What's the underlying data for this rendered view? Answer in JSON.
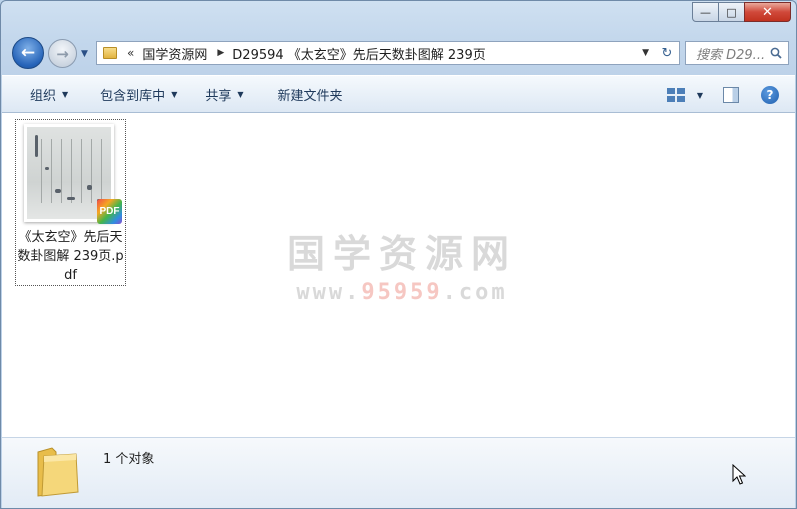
{
  "window": {
    "caption": {
      "minimize": "—",
      "maximize": "□",
      "close": "✕"
    }
  },
  "nav": {
    "address_prefix": "«",
    "crumbs": [
      "国学资源网",
      "D29594 《太玄空》先后天数卦图解 239页"
    ],
    "search_placeholder": "搜索 D29..."
  },
  "toolbar": {
    "organize": "组织",
    "include_in_library": "包含到库中",
    "share": "共享",
    "new_folder": "新建文件夹"
  },
  "files": [
    {
      "name": "《太玄空》先后天数卦图解 239页.pdf",
      "type_badge": "PDF"
    }
  ],
  "watermark": {
    "title": "国学资源网",
    "url_prefix": "www.",
    "url_highlight": "95959",
    "url_suffix": ".com"
  },
  "status": {
    "count": "1 个对象"
  },
  "colors": {
    "accent": "#2563b8",
    "watermark": "#d9d9d9",
    "close_button": "#c1321f"
  }
}
